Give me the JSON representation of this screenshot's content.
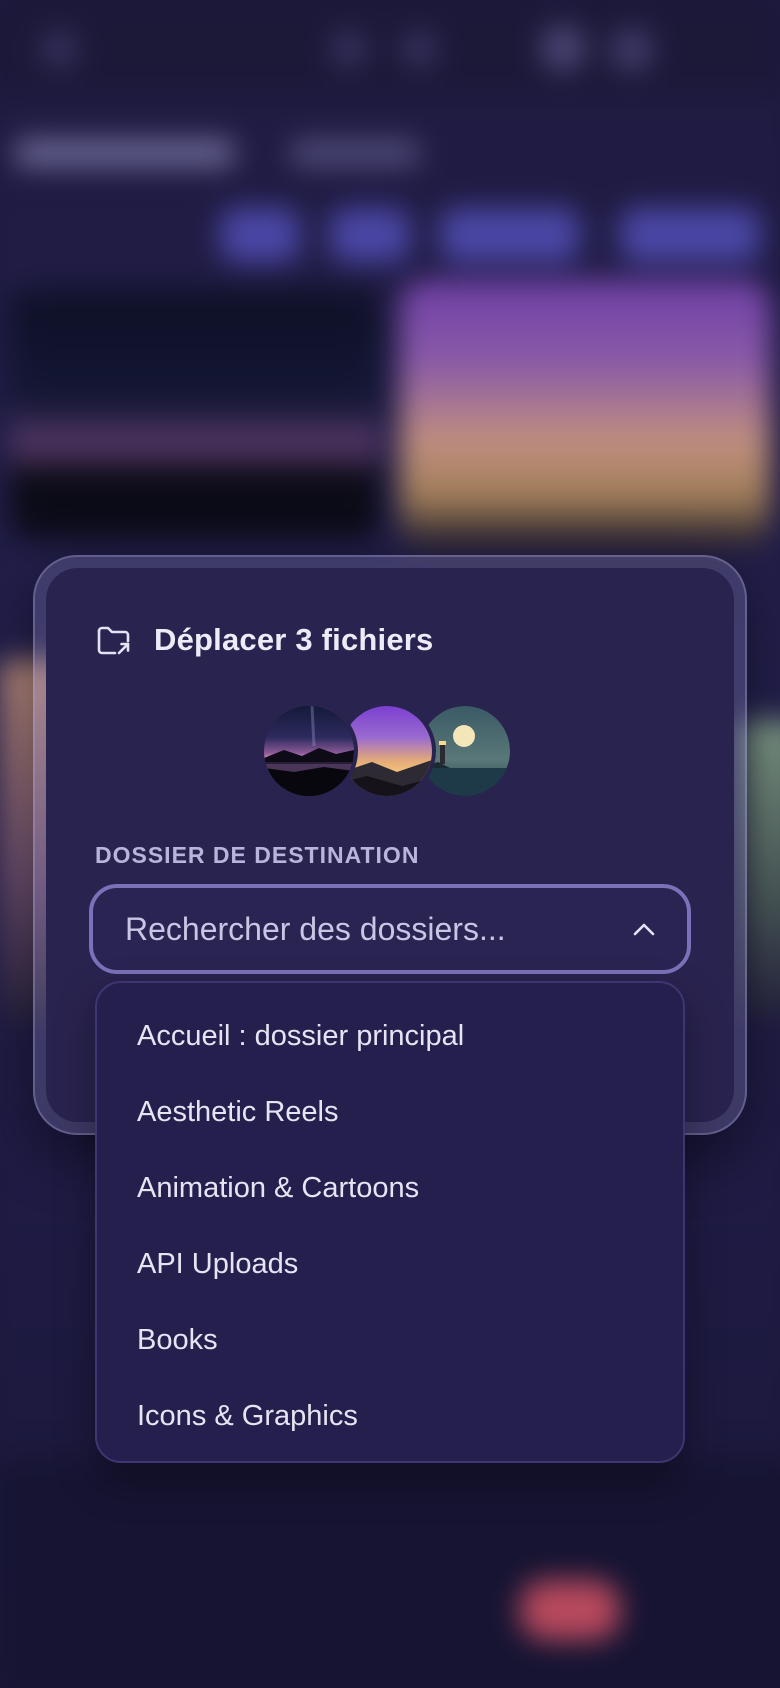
{
  "modal": {
    "title": "Déplacer 3 fichiers",
    "thumbnails": [
      {
        "name": "night-lake-thumbnail"
      },
      {
        "name": "purple-sunset-thumbnail"
      },
      {
        "name": "lighthouse-moon-thumbnail"
      }
    ],
    "destination_label": "DOSSIER DE DESTINATION",
    "search": {
      "value": "",
      "placeholder": "Rechercher des dossiers..."
    },
    "folders": [
      "Accueil : dossier principal",
      "Aesthetic Reels",
      "Animation & Cartoons",
      "API Uploads",
      "Books",
      "Icons & Graphics"
    ]
  },
  "colors": {
    "modal_background": "#29234f",
    "dropdown_background": "#251f4d",
    "accent_border": "#7a72b9",
    "text_primary": "#ecebf7",
    "text_label": "#b9b4de"
  },
  "icons": {
    "header": "folder-move-icon",
    "dropdown_toggle": "chevron-up-icon"
  }
}
